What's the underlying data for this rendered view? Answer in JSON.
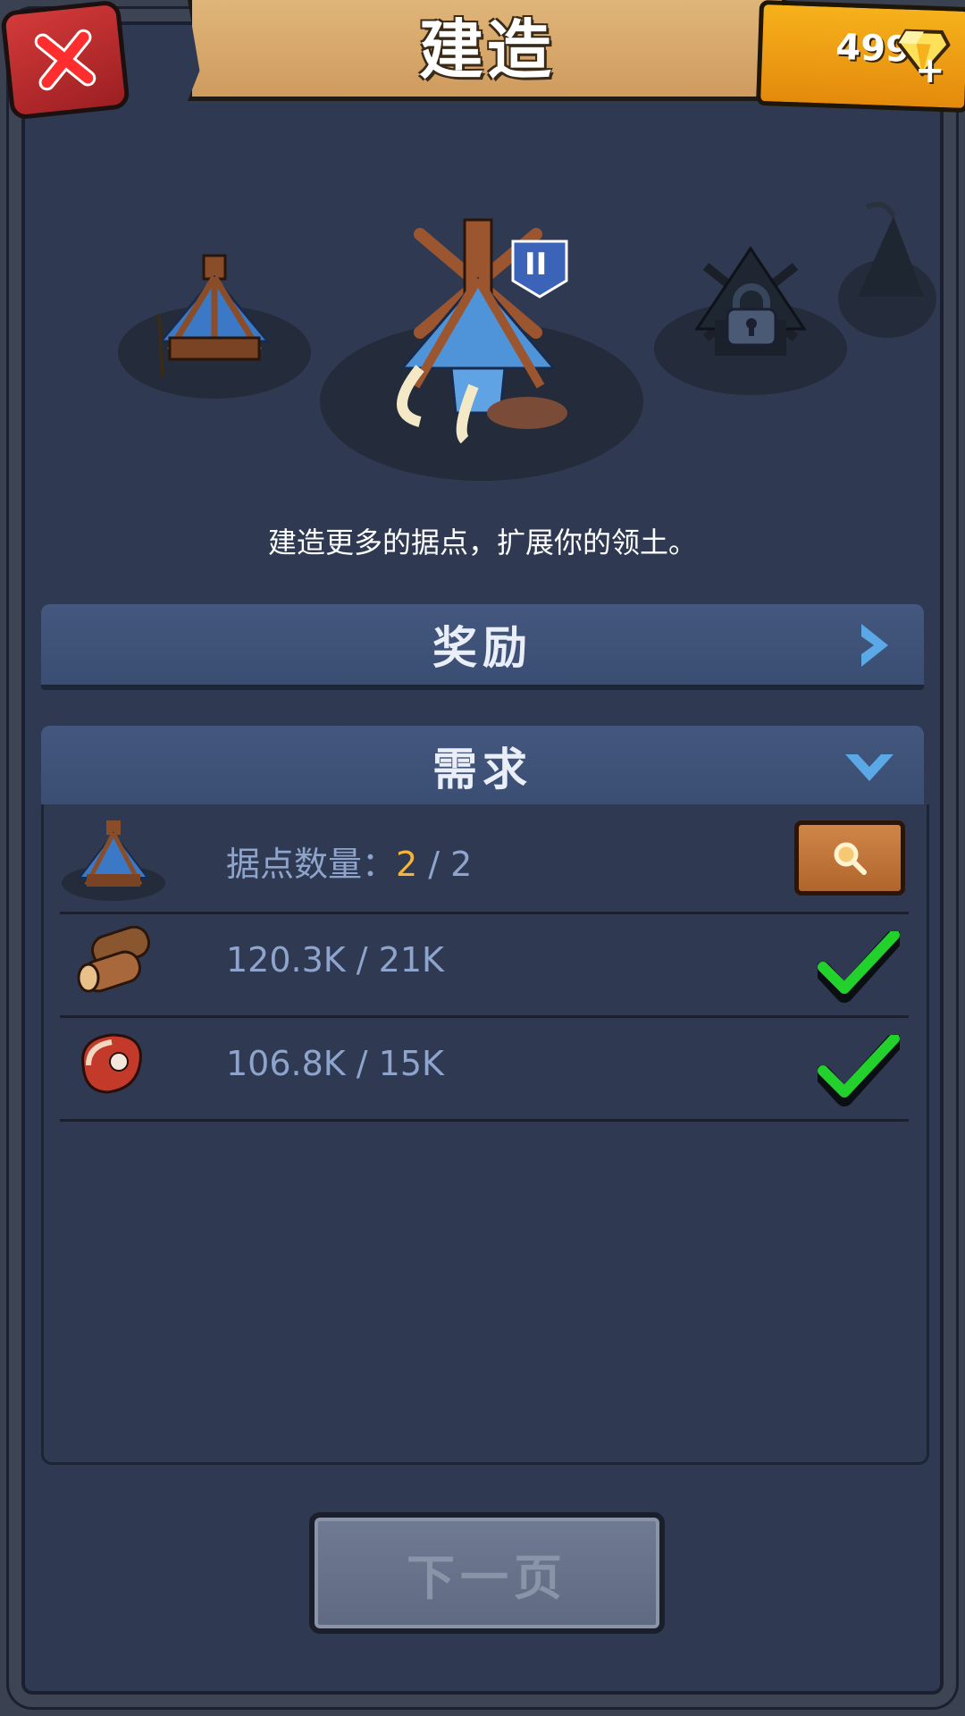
{
  "header": {
    "title": "建造",
    "close_icon": "close-x-icon",
    "gems": "499",
    "gem_icon": "diamond-icon",
    "gem_add": "+"
  },
  "building_carousel": {
    "badge_level": "II",
    "locked_icon": "padlock-icon"
  },
  "description": "建造更多的据点，扩展你的领土。",
  "rewards_section": {
    "label": "奖励",
    "chevron_icon": "chevron-right-icon"
  },
  "requirements_section": {
    "label": "需求",
    "chevron_icon": "chevron-down-icon",
    "rows": [
      {
        "icon": "outpost-icon",
        "label": "据点数量：",
        "current": "2",
        "sep": " / ",
        "required": "2",
        "action_icon": "magnifier-icon"
      },
      {
        "icon": "wood-log-icon",
        "text": "120.3K / 21K",
        "status_icon": "checkmark-icon"
      },
      {
        "icon": "meat-steak-icon",
        "text": "106.8K / 15K",
        "status_icon": "checkmark-icon"
      }
    ]
  },
  "footer": {
    "next_label": "下一页"
  },
  "colors": {
    "panel_bg": "#2f3a52",
    "section_header": "#3a4d72",
    "accent_gold": "#f6b43a",
    "check_green": "#22d12b",
    "text_blue": "#8ea4cc"
  }
}
